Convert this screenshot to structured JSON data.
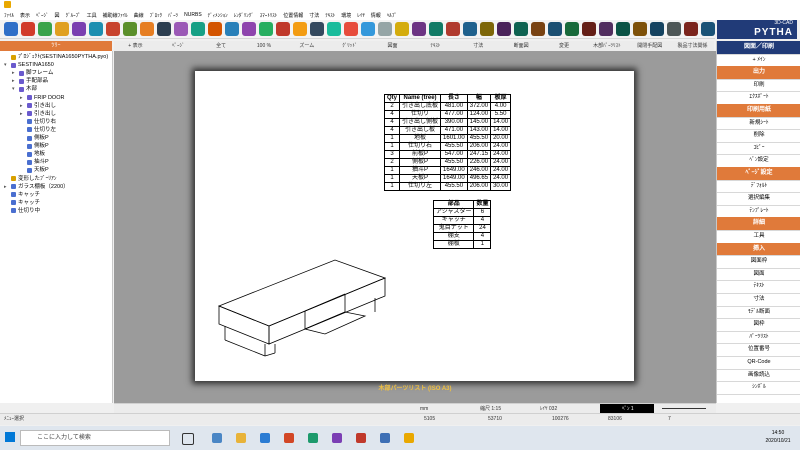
{
  "menu": [
    "ﾌｧｲﾙ",
    "表示",
    "ﾍﾟｰｼﾞ",
    "図",
    "ｸﾞﾙｰﾌﾟ",
    "工具",
    "補助線ﾌｧｲﾙ",
    "曲線",
    "ﾌﾞﾛｯｸ",
    "ﾊﾟｰﾂ",
    "NURBS",
    "ﾃﾞｨﾒﾝｼｮﾝ",
    "ﾚﾝﾀﾞﾘﾝｸﾞ",
    "ｽﾏｰﾄﾘｽﾄ",
    "位置情報",
    "寸法",
    "ﾃｷｽﾄ",
    "環境",
    "ﾚｲﾔ",
    "情報",
    "ﾍﾙﾌﾟ"
  ],
  "logo": {
    "line1": "3D-CAD",
    "line2": "PYTHA"
  },
  "tree": {
    "header": "ﾂﾘｰ",
    "items": [
      {
        "label": "ﾌﾟﾛｼﾞｪｸﾄ(SESTINA1650PYTHA.pyo)",
        "level": 0,
        "color": "#d8a000"
      },
      {
        "label": "SESTINA1650",
        "level": 0,
        "color": "#6a5acd",
        "arrow": "▾"
      },
      {
        "label": "脚フレーム",
        "level": 1,
        "color": "#6a5acd",
        "arrow": "▸"
      },
      {
        "label": "手配部品",
        "level": 1,
        "color": "#6a5acd",
        "arrow": "▸"
      },
      {
        "label": "木部",
        "level": 1,
        "color": "#6a5acd",
        "arrow": "▾"
      },
      {
        "label": "FRIP DOOR",
        "level": 2,
        "color": "#6a5acd",
        "arrow": "▸"
      },
      {
        "label": "引き出し",
        "level": 2,
        "color": "#6a5acd",
        "arrow": "▸"
      },
      {
        "label": "引き出し",
        "level": 2,
        "color": "#6a5acd",
        "arrow": "▸"
      },
      {
        "label": "仕切り右",
        "level": 2,
        "color": "#4a6fd0"
      },
      {
        "label": "仕切り左",
        "level": 2,
        "color": "#4a6fd0"
      },
      {
        "label": "側板P",
        "level": 2,
        "color": "#4a6fd0"
      },
      {
        "label": "側板P",
        "level": 2,
        "color": "#4a6fd0"
      },
      {
        "label": "地板",
        "level": 2,
        "color": "#4a6fd0"
      },
      {
        "label": "抽斗P",
        "level": 2,
        "color": "#4a6fd0"
      },
      {
        "label": "天板P",
        "level": 2,
        "color": "#4a6fd0"
      },
      {
        "label": "変形したﾌﾞｰﾘｱﾝ",
        "level": 0,
        "color": "#d8a000"
      },
      {
        "label": "ガラス棚板（2200）",
        "level": 0,
        "color": "#4a6fd0",
        "arrow": "▸"
      },
      {
        "label": "キャッチ",
        "level": 0,
        "color": "#4a6fd0"
      },
      {
        "label": "キャッチ",
        "level": 0,
        "color": "#4a6fd0"
      },
      {
        "label": "仕切り中",
        "level": 0,
        "color": "#4a6fd0"
      }
    ]
  },
  "view_tabs": [
    "+ 表示",
    "ﾍﾟｰｼﾞ",
    "全て",
    "100 %",
    "ズーム",
    "ｸﾞﾘｯﾄﾞ",
    "図面",
    "ﾃｷｽﾄ",
    "寸法",
    "断面図",
    "変更",
    "木部ﾊﾟｰﾂﾘｽﾄ",
    "開閉手配図",
    "製品寸法関係"
  ],
  "parts_table": {
    "headers": [
      "Qty",
      "Name (tree)",
      "長さ",
      "幅",
      "板厚"
    ],
    "rows": [
      [
        "2",
        "引き出し底板",
        "481.00",
        "372.00",
        "4.00"
      ],
      [
        "4",
        "仕切り",
        "477.00",
        "124.00",
        "5.50"
      ],
      [
        "4",
        "引き出し側板",
        "390.00",
        "145.00",
        "14.00"
      ],
      [
        "4",
        "引き出し板",
        "471.00",
        "143.00",
        "14.00"
      ],
      [
        "1",
        "地板",
        "1601.00",
        "455.50",
        "20.00"
      ],
      [
        "1",
        "仕切り右",
        "455.50",
        "206.00",
        "24.00"
      ],
      [
        "3",
        "前板P",
        "547.00",
        "247.15",
        "24.00"
      ],
      [
        "2",
        "側板P",
        "455.50",
        "226.00",
        "24.00"
      ],
      [
        "1",
        "抽斗P",
        "1649.00",
        "246.00",
        "24.00"
      ],
      [
        "1",
        "天板P",
        "1649.00",
        "496.65",
        "24.00"
      ],
      [
        "1",
        "仕切り左",
        "455.50",
        "206.00",
        "30.00"
      ]
    ]
  },
  "hardware_table": {
    "headers": [
      "部品",
      "数量"
    ],
    "rows": [
      [
        "アジャスター",
        "6"
      ],
      [
        "キャッチ",
        "4"
      ],
      [
        "鬼目ナット",
        "24"
      ],
      [
        "棚支",
        "4"
      ],
      [
        "棚板",
        "1"
      ]
    ]
  },
  "sheet_caption": "木部パーツリスト (ISO A3)",
  "right_panel": [
    {
      "label": "図面／印刷",
      "style": "blue"
    },
    {
      "label": "+ ﾒｲﾝ",
      "style": "plain"
    },
    {
      "label": "出力",
      "style": "orange"
    },
    {
      "label": "印刷",
      "style": "plain"
    },
    {
      "label": "ｴｸｽﾎﾟｰﾄ",
      "style": "plain"
    },
    {
      "label": "印刷用紙",
      "style": "orange"
    },
    {
      "label": "新規ｼｰﾄ",
      "style": "plain"
    },
    {
      "label": "削除",
      "style": "plain"
    },
    {
      "label": "ｺﾋﾟｰ",
      "style": "plain"
    },
    {
      "label": "ﾍﾟﾝ設定",
      "style": "plain"
    },
    {
      "label": "ﾍﾟｰｼﾞ設定",
      "style": "orange"
    },
    {
      "label": "ﾃﾞﾌｫﾙﾄ",
      "style": "plain"
    },
    {
      "label": "選択編集",
      "style": "plain"
    },
    {
      "label": "ﾃﾝﾌﾟﾚｰﾄ",
      "style": "plain"
    },
    {
      "label": "詳細",
      "style": "orange"
    },
    {
      "label": "工具",
      "style": "plain"
    },
    {
      "label": "挿入",
      "style": "orange"
    },
    {
      "label": "図面枠",
      "style": "plain"
    },
    {
      "label": "図面",
      "style": "plain"
    },
    {
      "label": "ﾃｷｽﾄ",
      "style": "plain"
    },
    {
      "label": "寸法",
      "style": "plain"
    },
    {
      "label": "ﾓﾃﾞﾙ断面",
      "style": "plain"
    },
    {
      "label": "図枠",
      "style": "plain"
    },
    {
      "label": "ﾊﾟｰﾂﾘｽﾄ",
      "style": "plain"
    },
    {
      "label": "位置番号",
      "style": "plain"
    },
    {
      "label": "QR-Code",
      "style": "plain"
    },
    {
      "label": "画像読込",
      "style": "plain"
    },
    {
      "label": "ｼﾝﾎﾞﾙ",
      "style": "plain"
    }
  ],
  "status": {
    "units": "mm",
    "scale": "縮尺 1:15",
    "layer": "ﾚｲﾔ 032",
    "pen": "ﾍﾟﾝ 1",
    "menu_select": "ﾒﾆｭｰ選択",
    "c1": "5105",
    "c2": "53710",
    "c3": "100276",
    "c4": "83106",
    "c5": "7"
  },
  "taskbar": {
    "search_placeholder": "ここに入力して検索",
    "time": "14:50",
    "date": "2020/10/21"
  }
}
